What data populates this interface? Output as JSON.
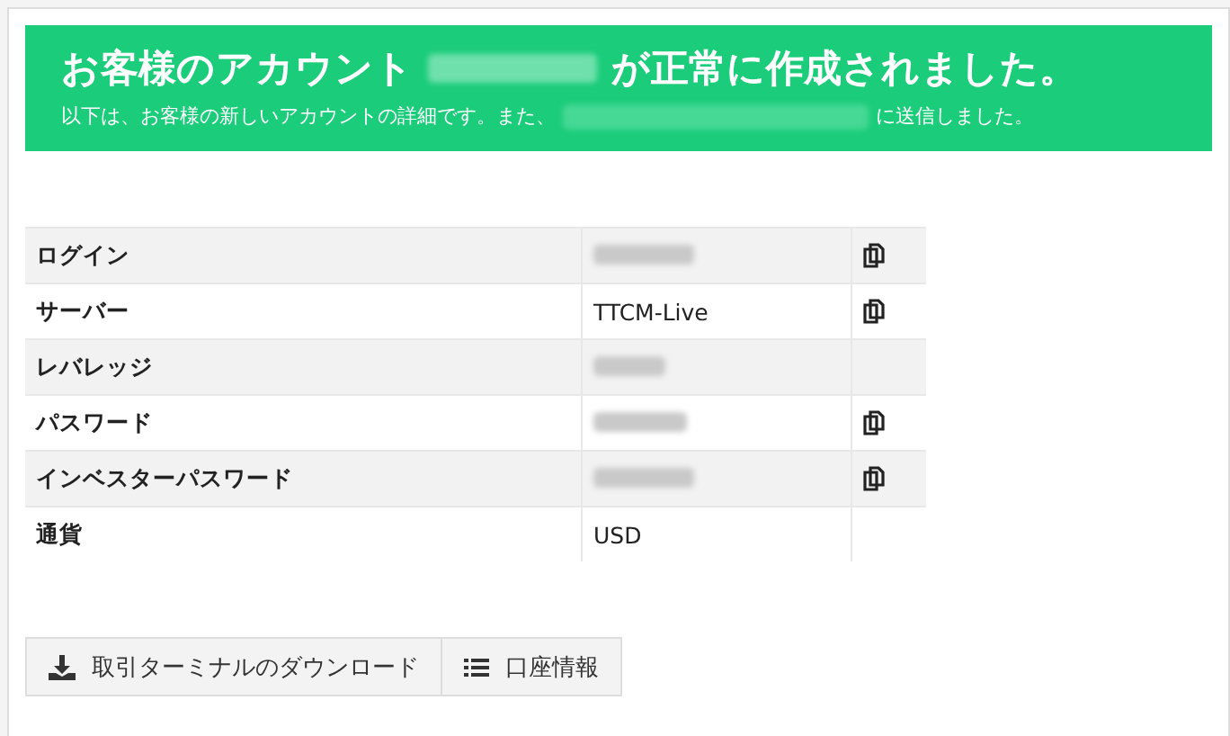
{
  "banner": {
    "title_before": "お客様のアカウント",
    "title_after": "が正常に作成されました。",
    "message_before": "以下は、お客様の新しいアカウントの詳細です。また、",
    "message_after": "に送信しました。"
  },
  "details": [
    {
      "label": "ログイン",
      "value": {
        "kind": "redacted"
      },
      "copyable": true
    },
    {
      "label": "サーバー",
      "value": {
        "kind": "text",
        "text": "TTCM-Live"
      },
      "copyable": true
    },
    {
      "label": "レバレッジ",
      "value": {
        "kind": "redacted"
      },
      "copyable": false
    },
    {
      "label": "パスワード",
      "value": {
        "kind": "redacted"
      },
      "copyable": true
    },
    {
      "label": "インベスターパスワード",
      "value": {
        "kind": "redacted"
      },
      "copyable": true
    },
    {
      "label": "通貨",
      "value": {
        "kind": "text",
        "text": "USD"
      },
      "copyable": false
    }
  ],
  "buttons": [
    {
      "kind": "download",
      "label": "取引ターミナルのダウンロード"
    },
    {
      "kind": "list",
      "label": "口座情報"
    }
  ]
}
